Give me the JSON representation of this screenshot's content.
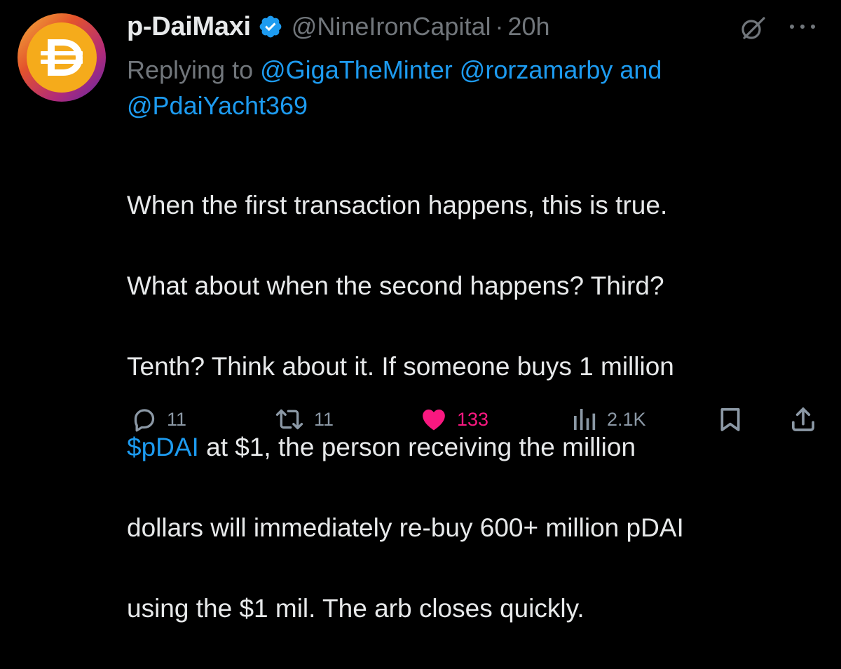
{
  "author": {
    "display_name": "p-DaiMaxi",
    "handle": "@NineIronCapital",
    "separator": "·",
    "time": "20h",
    "avatar_symbol": "Đ"
  },
  "reply_to": {
    "prefix": "Replying to",
    "mention_1": "@GigaTheMinter",
    "mention_2": "@rorzamarby",
    "conjunction": "and",
    "mention_3": "@PdaiYacht369"
  },
  "body": {
    "line_1": "When the first transaction happens, this is true.",
    "line_2": "What about when the second happens? Third?",
    "line_3": "Tenth? Think about it. If someone buys 1 million",
    "cashtag": "$pDAI",
    "line_4_rest": " at $1, the person receiving the million",
    "line_5": "dollars will immediately re-buy 600+ million pDAI",
    "line_6": "using the $1 mil. The arb closes quickly."
  },
  "actions": {
    "replies": "11",
    "retweets": "11",
    "likes": "133",
    "views": "2.1K"
  },
  "icons": {
    "verified": "verified-badge-icon",
    "grok": "grok-icon",
    "more": "more-icon",
    "reply": "reply-icon",
    "retweet": "retweet-icon",
    "like": "heart-icon",
    "views": "views-icon",
    "bookmark": "bookmark-icon",
    "share": "share-icon"
  },
  "colors": {
    "background": "#000000",
    "text": "#e7e9ea",
    "secondary": "#71767b",
    "link": "#1d9bf0",
    "like": "#f91880"
  }
}
